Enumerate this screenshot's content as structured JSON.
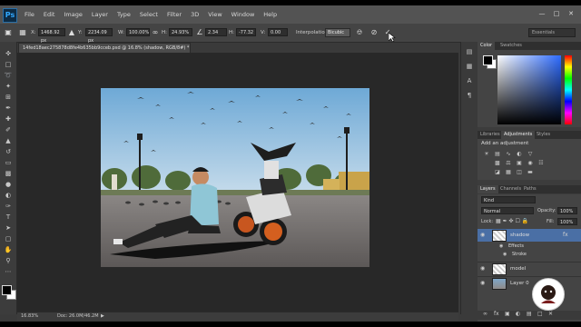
{
  "app": {
    "logo": "Ps"
  },
  "menus": [
    "File",
    "Edit",
    "Image",
    "Layer",
    "Type",
    "Select",
    "Filter",
    "3D",
    "View",
    "Window",
    "Help"
  ],
  "options": {
    "x_label": "X:",
    "x_value": "1468.92 px",
    "y_label": "Y:",
    "y_value": "2234.09 px",
    "w_label": "W:",
    "w_value": "100.00%",
    "h_label": "H:",
    "h_value": "24.93%",
    "angle_value": "2.34",
    "hskew_label": "H:",
    "hskew_value": "-77.32",
    "vskew_label": "V:",
    "vskew_value": "0.00",
    "interpolation_label": "Interpolation:",
    "interpolation_value": "Bicubic",
    "workspace": "Essentials"
  },
  "document": {
    "tab_title": "14fed18aec275878d8fe4b635bb9cceb.psd @ 16.8% (shadow, RGB/8#) *",
    "zoom": "16.83%",
    "doc_size": "Doc: 26.0M/46.2M"
  },
  "color_panel": {
    "tabs": [
      "Color",
      "Swatches"
    ]
  },
  "adjust_panel": {
    "tabs": [
      "Libraries",
      "Adjustments",
      "Styles"
    ],
    "title": "Add an adjustment"
  },
  "layers_panel": {
    "tabs": [
      "Layers",
      "Channels",
      "Paths"
    ],
    "kind_label": "Kind",
    "blend_mode": "Normal",
    "opacity_label": "Opacity:",
    "opacity": "100%",
    "lock_label": "Lock:",
    "fill_label": "Fill:",
    "fill": "100%",
    "layers": [
      {
        "name": "shadow",
        "selected": true
      },
      {
        "name": "Effects",
        "sub": true
      },
      {
        "name": "Stroke",
        "sub": true
      },
      {
        "name": "model"
      },
      {
        "name": "Layer 0"
      }
    ]
  },
  "colors": {
    "accent": "#31a8ff",
    "selected_layer": "#4a6fa5"
  }
}
